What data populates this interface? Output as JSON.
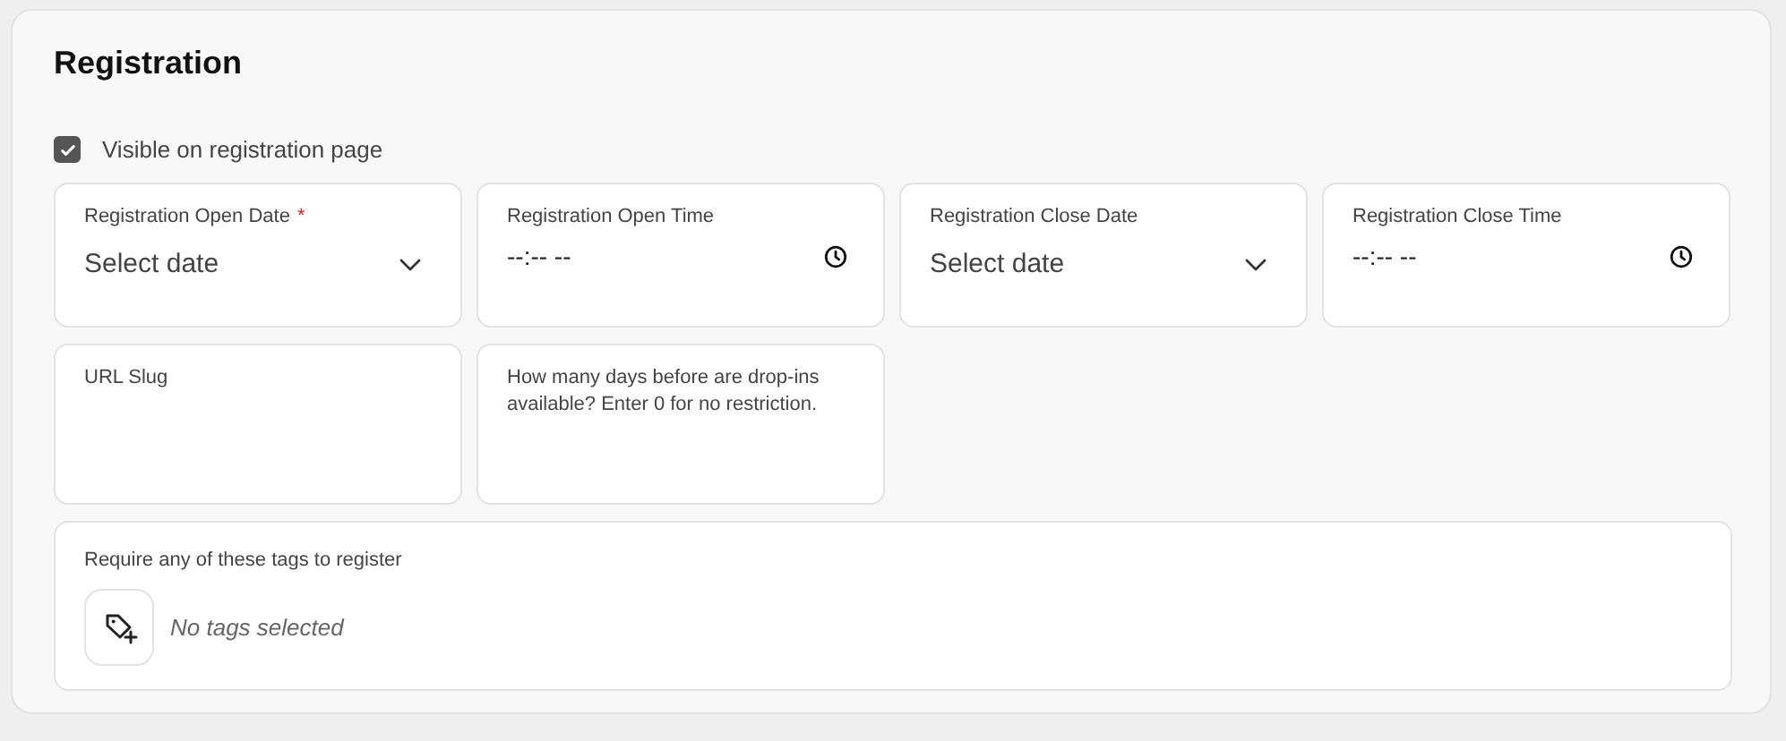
{
  "title": "Registration",
  "visible": {
    "label": "Visible on registration page",
    "checked": true
  },
  "fields": [
    {
      "kind": "date",
      "label": "Registration Open Date",
      "required_mark": "*",
      "placeholder": "Select date"
    },
    {
      "kind": "time",
      "label": "Registration Open Time",
      "placeholder": "--:-- --"
    },
    {
      "kind": "date",
      "label": "Registration Close Date",
      "placeholder": "Select date"
    },
    {
      "kind": "time",
      "label": "Registration Close Time",
      "placeholder": "--:-- --"
    },
    {
      "kind": "text",
      "label": "URL Slug"
    },
    {
      "kind": "text",
      "label": "How many days before are drop-ins available? Enter 0 for no restriction."
    }
  ],
  "tags": {
    "label": "Require any of these tags to register",
    "empty_text": "No tags selected"
  }
}
